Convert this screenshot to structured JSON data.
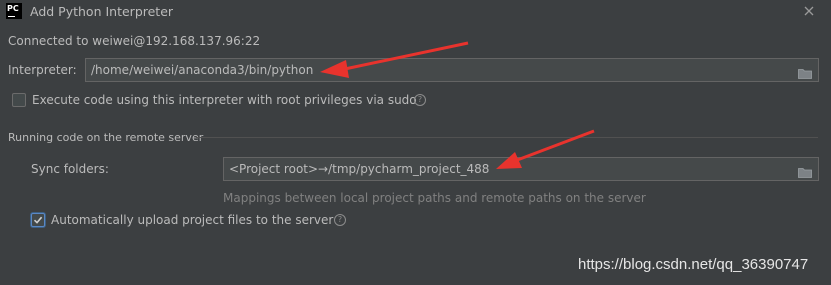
{
  "window": {
    "title": "Add Python Interpreter",
    "app_icon_label": "PC"
  },
  "connection": {
    "text": "Connected to weiwei@192.168.137.96:22"
  },
  "interpreter": {
    "label": "Interpreter:",
    "value": "/home/weiwei/anaconda3/bin/python"
  },
  "sudo": {
    "label": "Execute code using this interpreter with root privileges via sudo",
    "checked": false
  },
  "remote_section": {
    "title": "Running code on the remote server"
  },
  "sync": {
    "label": "Sync folders:",
    "value": "<Project root>→/tmp/pycharm_project_488",
    "hint": "Mappings between local project paths and remote paths on the server"
  },
  "auto_upload": {
    "label": "Automatically upload project files to the server",
    "checked": true
  },
  "watermark": {
    "text": "https://blog.csdn.net/qq_36390747"
  },
  "colors": {
    "background": "#3c3f41",
    "field_background": "#45494a",
    "annotation_arrow": "#e8332d",
    "checkbox_accent": "#5a88c6"
  },
  "icons": [
    "pycharm-logo",
    "close-icon",
    "folder-icon",
    "help-icon",
    "checkmark-icon",
    "arrow-annotation"
  ]
}
